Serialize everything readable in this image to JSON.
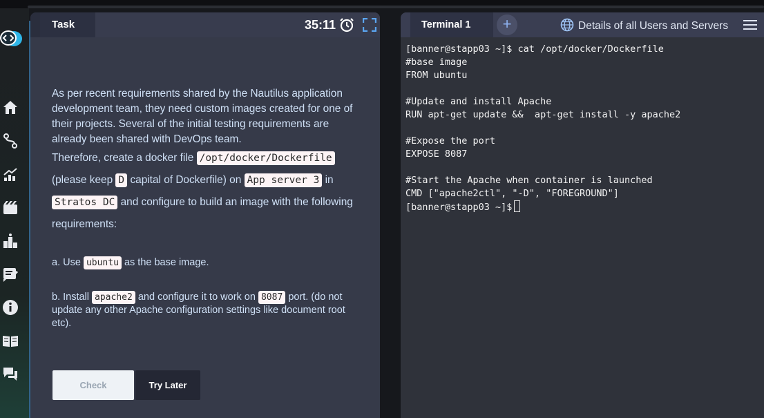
{
  "task": {
    "tab_label": "Task",
    "timer": "35:11",
    "intro": {
      "p1": "As per recent requirements shared by the Nautilus application development team, they need custom images created for one of their projects. Several of the initial testing requirements are already been shared with DevOps team.",
      "p2_text1": "Therefore, create a docker file",
      "dockerfile_path": "/opt/docker/Dockerfile",
      "p2_text2": "(please keep",
      "d_letter": "D",
      "p2_text3": "capital of Dockerfile) on",
      "server": "App server 3",
      "p2_text4": "in",
      "datacenter": "Stratos DC",
      "p2_text5": "and configure to build an image with the following requirements:"
    },
    "req_a": {
      "prefix": "a. Use",
      "base_image": "ubuntu",
      "suffix": "as the base image."
    },
    "req_b": {
      "prefix": "b. Install",
      "package": "apache2",
      "middle": "and configure it to work on",
      "port": "8087",
      "suffix": "port. (do not update any other Apache configuration settings like document root etc)."
    },
    "buttons": {
      "check": "Check",
      "try_later": "Try Later"
    }
  },
  "terminal": {
    "tab_label": "Terminal 1",
    "add_label": "+",
    "details_link": "Details of all Users and Servers",
    "lines": [
      "[banner@stapp03 ~]$ cat /opt/docker/Dockerfile",
      "#base image",
      "FROM ubuntu",
      "",
      "#Update and install Apache",
      "RUN apt-get update &&  apt-get install -y apache2",
      "",
      "#Expose the port",
      "EXPOSE 8087",
      "",
      "#Start the Apache when container is launched",
      "CMD [\"apache2ctl\", \"-D\", \"FOREGROUND\"]"
    ],
    "prompt": "[banner@stapp03 ~]$"
  },
  "sidebar_icons": [
    "logo-icon",
    "home-icon",
    "path-icon",
    "chart-icon",
    "film-icon",
    "leaderboard-icon",
    "notes-icon",
    "info-icon",
    "book-icon",
    "chat-icon"
  ],
  "colors": {
    "task_bg": "#363a49",
    "terminal_bg": "#2f323a",
    "accent": "#4ba3e6",
    "code_bg": "#fdf4f6"
  }
}
